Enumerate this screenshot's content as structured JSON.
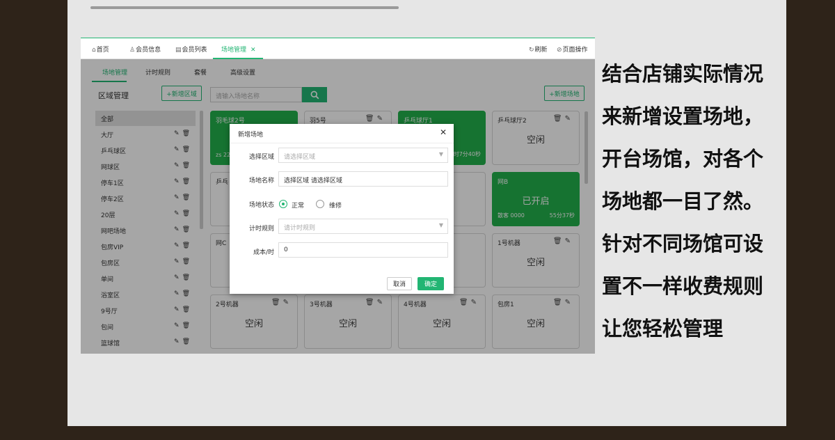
{
  "tabs": [
    {
      "label": "首页",
      "icon": "home-icon"
    },
    {
      "label": "会员信息",
      "icon": "user-icon"
    },
    {
      "label": "会员列表",
      "icon": "list-icon"
    },
    {
      "label": "场地管理",
      "icon": "",
      "active": true
    }
  ],
  "top_actions": {
    "refresh": "刷新",
    "page_ops": "页面操作"
  },
  "subtabs": [
    "场地管理",
    "计时规则",
    "套餐",
    "高级设置"
  ],
  "sidebar": {
    "title": "区域管理",
    "add_region": "+新增区域",
    "regions": [
      "全部",
      "大厅",
      "乒乓球区",
      "网球区",
      "停车1区",
      "停车2区",
      "20层",
      "网吧场地",
      "包房VIP",
      "包房区",
      "单间",
      "浴室区",
      "9号厅",
      "包间",
      "篮球馆"
    ]
  },
  "search": {
    "placeholder": "请输入场地名称"
  },
  "add_venue": "+新增场地",
  "cards": [
    {
      "name": "羽毛球2号",
      "status": "",
      "foot_l": "zs 223",
      "foot_r": "",
      "green": true
    },
    {
      "name": "羽5号",
      "status": "",
      "foot_l": "",
      "foot_r": "",
      "green": false
    },
    {
      "name": "乒乓球厅1",
      "status": "",
      "foot_l": "",
      "foot_r": "时7分40秒",
      "green": true
    },
    {
      "name": "乒乓球厅2",
      "status": "空闲",
      "foot_l": "",
      "foot_r": "",
      "green": false
    },
    {
      "name": "乒乓",
      "status": "",
      "foot_l": "",
      "foot_r": "",
      "green": false
    },
    {
      "name": "",
      "status": "",
      "foot_l": "",
      "foot_r": "",
      "green": false
    },
    {
      "name": "",
      "status": "",
      "foot_l": "",
      "foot_r": "",
      "green": false
    },
    {
      "name": "网B",
      "status": "已开启",
      "foot_l": "散客 0000",
      "foot_r": "55分37秒",
      "green": true
    },
    {
      "name": "网C",
      "status": "",
      "foot_l": "",
      "foot_r": "",
      "green": false
    },
    {
      "name": "",
      "status": "",
      "foot_l": "",
      "foot_r": "",
      "green": false
    },
    {
      "name": "",
      "status": "",
      "foot_l": "",
      "foot_r": "",
      "green": false
    },
    {
      "name": "1号机器",
      "status": "空闲",
      "foot_l": "",
      "foot_r": "",
      "green": false
    },
    {
      "name": "2号机器",
      "status": "空闲",
      "foot_l": "",
      "foot_r": "",
      "green": false
    },
    {
      "name": "3号机器",
      "status": "空闲",
      "foot_l": "",
      "foot_r": "",
      "green": false
    },
    {
      "name": "4号机器",
      "status": "空闲",
      "foot_l": "",
      "foot_r": "",
      "green": false
    },
    {
      "name": "包房1",
      "status": "空闲",
      "foot_l": "",
      "foot_r": "",
      "green": false
    }
  ],
  "modal": {
    "title": "新增场地",
    "fields": {
      "region_label": "选择区域",
      "region_placeholder": "请选择区域",
      "name_label": "场地名称",
      "name_value": "选择区域  请选择区域",
      "status_label": "场地状态",
      "status_normal": "正常",
      "status_repair": "维修",
      "rule_label": "计时规则",
      "rule_placeholder": "请计时规则",
      "cost_label": "成本/时",
      "cost_value": "0"
    },
    "cancel": "取消",
    "confirm": "确定"
  },
  "caption": [
    "结合店铺实际情况",
    "来新增设置场地，",
    "开台场馆，对各个",
    "场地都一目了然。",
    "针对不同场馆可设",
    "置不一样收费规则",
    "让您轻松管理"
  ],
  "colors": {
    "accent": "#22b573",
    "card_green": "#22b14c",
    "background": "#2e2319"
  }
}
